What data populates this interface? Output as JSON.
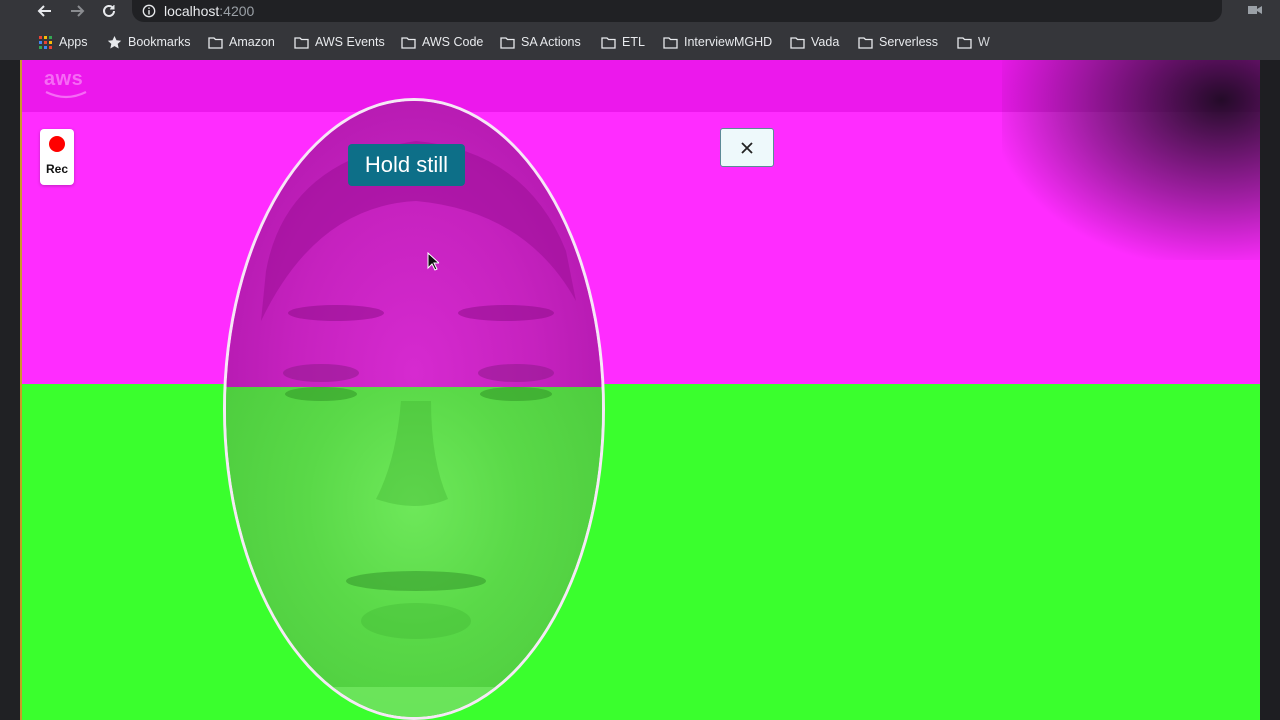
{
  "browser": {
    "url_host": "localhost",
    "url_port": ":4200",
    "nav_icons": [
      "back-arrow-icon",
      "forward-arrow-icon",
      "reload-icon",
      "info-icon",
      "camera-icon"
    ]
  },
  "bookmarks": [
    {
      "label": "Apps",
      "icon": "apps-grid-icon"
    },
    {
      "label": "Bookmarks",
      "icon": "star-icon"
    },
    {
      "label": "Amazon",
      "icon": "folder-icon"
    },
    {
      "label": "AWS Events",
      "icon": "folder-icon"
    },
    {
      "label": "AWS Code",
      "icon": "folder-icon"
    },
    {
      "label": "SA Actions",
      "icon": "folder-icon"
    },
    {
      "label": "ETL",
      "icon": "folder-icon"
    },
    {
      "label": "InterviewMGHD",
      "icon": "folder-icon"
    },
    {
      "label": "Vada",
      "icon": "folder-icon"
    },
    {
      "label": "Serverless",
      "icon": "folder-icon"
    },
    {
      "label": "W",
      "icon": "folder-icon"
    }
  ],
  "app": {
    "logo_text": "aws",
    "rec_label": "Rec",
    "status_text": "Hold still",
    "close_icon": "close-icon",
    "colors": {
      "top_flash": "#ff2cff",
      "bottom_flash": "#3aff2d",
      "status_badge": "#0d6f88",
      "rec_dot": "#ff0000"
    }
  }
}
